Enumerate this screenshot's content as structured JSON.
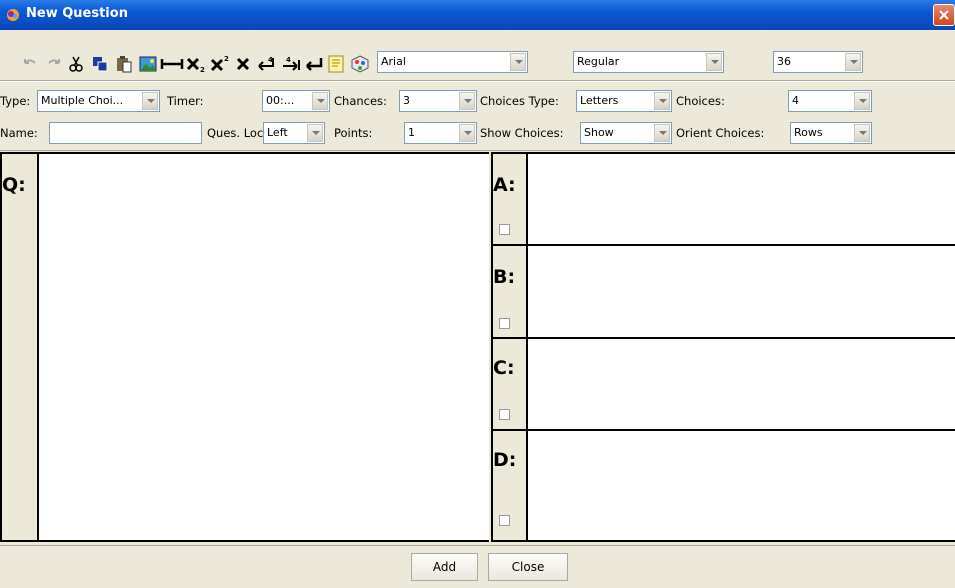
{
  "window": {
    "title": "New Question",
    "close_label": ""
  },
  "toolbar": {
    "font_family": "Arial",
    "font_style": "Regular",
    "font_size": "36",
    "icons": [
      "undo-icon",
      "redo-icon",
      "cut-icon",
      "copy-icon",
      "paste-icon",
      "insert-image-icon",
      "horizontal-line-icon",
      "subscript-icon",
      "superscript-icon",
      "clear-format-icon",
      "indent-left-icon",
      "indent-right-icon",
      "line-break-icon",
      "note-icon",
      "object-icon"
    ]
  },
  "settings": {
    "type_label": "Type:",
    "type_value": "Multiple Choi...",
    "timer_label": "Timer:",
    "timer_value": "00:...",
    "chances_label": "Chances:",
    "chances_value": "3",
    "choices_type_label": "Choices Type:",
    "choices_type_value": "Letters",
    "choices_label": "Choices:",
    "choices_value": "4",
    "name_label": "Name:",
    "name_value": "",
    "ques_location_label": "Ques. Location:",
    "ques_location_value": "Left",
    "points_label": "Points:",
    "points_value": "1",
    "show_choices_label": "Show Choices:",
    "show_choices_value": "Show",
    "orient_choices_label": "Orient Choices:",
    "orient_choices_value": "Rows"
  },
  "question": {
    "label": "Q:"
  },
  "answers": [
    {
      "label": "A:"
    },
    {
      "label": "B:"
    },
    {
      "label": "C:"
    },
    {
      "label": "D:"
    }
  ],
  "footer": {
    "add_label": "Add",
    "close_label": "Close"
  }
}
